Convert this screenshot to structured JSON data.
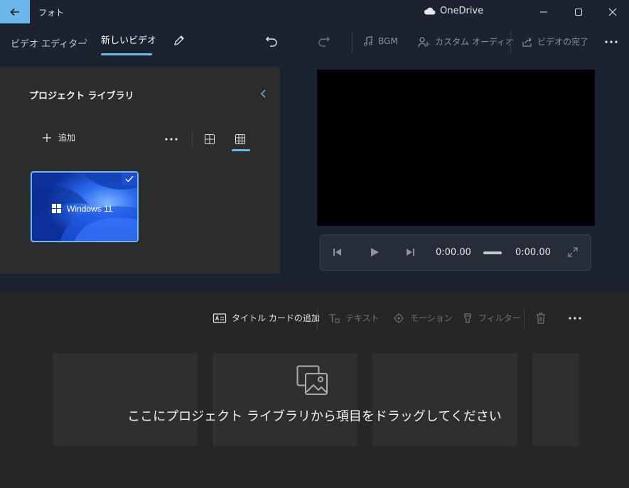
{
  "window": {
    "app_title": "フォト",
    "cloud_label": "OneDrive"
  },
  "header": {
    "breadcrumb_parent": "ビデオ エディター",
    "breadcrumb_current": "新しいビデオ",
    "toolbar": {
      "bgm_label": "BGM",
      "custom_audio_label": "カスタム オーディオ",
      "finish_video_label": "ビデオの完了"
    }
  },
  "library": {
    "title": "プロジェクト ライブラリ",
    "add_label": "追加",
    "items": [
      {
        "caption": "Windows 11",
        "selected": true
      }
    ]
  },
  "player": {
    "current_time": "0:00.00",
    "total_time": "0:00.00"
  },
  "storyboard": {
    "add_title_card_label": "タイトル カードの追加",
    "text_label": "テキスト",
    "motion_label": "モーション",
    "filter_label": "フィルター",
    "drop_message": "ここにプロジェクト ライブラリから項目をドラッグしてください"
  },
  "colors": {
    "accent": "#6cb8ea",
    "titlebar_bg": "#1c2330",
    "panel_bg": "#2b2c2e",
    "storyboard_bg": "#262626"
  }
}
